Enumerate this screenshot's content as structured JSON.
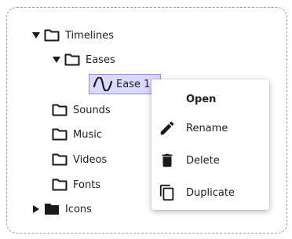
{
  "tree": {
    "items": [
      {
        "label": "Timelines",
        "expanded": true,
        "icon": "folder-outline-icon"
      },
      {
        "label": "Eases",
        "expanded": true,
        "icon": "folder-outline-icon"
      },
      {
        "label": "Ease 1",
        "selected": true,
        "icon": "sine-wave-icon"
      },
      {
        "label": "Sounds",
        "icon": "folder-outline-icon"
      },
      {
        "label": "Music",
        "icon": "folder-outline-icon"
      },
      {
        "label": "Videos",
        "icon": "folder-outline-icon"
      },
      {
        "label": "Fonts",
        "icon": "folder-outline-icon"
      },
      {
        "label": "Icons",
        "expanded": false,
        "icon": "folder-filled-icon"
      }
    ]
  },
  "context_menu": {
    "items": [
      {
        "label": "Open",
        "icon": ""
      },
      {
        "label": "Rename",
        "icon": "pencil-icon"
      },
      {
        "label": "Delete",
        "icon": "trash-icon"
      },
      {
        "label": "Duplicate",
        "icon": "duplicate-icon"
      }
    ]
  },
  "colors": {
    "selection_fill": "#dcd8ff",
    "selection_border": "#8f87ff",
    "panel_border": "#9e9e9e"
  }
}
